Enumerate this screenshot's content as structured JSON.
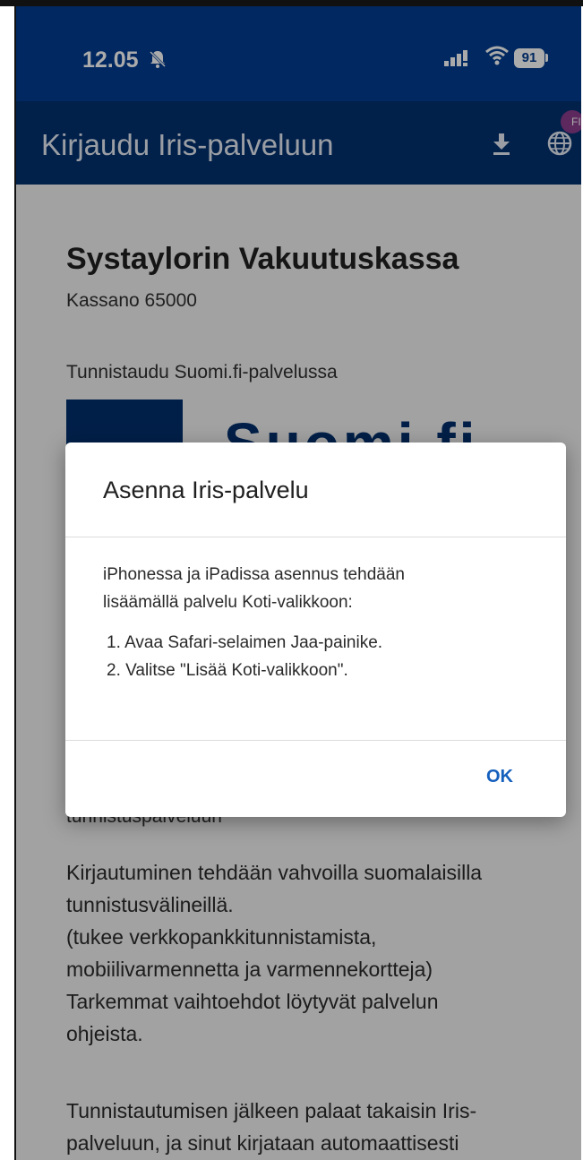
{
  "status_bar": {
    "time": "12.05",
    "battery": "91"
  },
  "app_bar": {
    "title": "Kirjaudu Iris-palveluun",
    "language_badge": "FI"
  },
  "page": {
    "heading": "Systaylorin Vakuutuskassa",
    "kassano": "Kassano 65000",
    "identify_prompt": "Tunnistaudu Suomi.fi-palvelussa",
    "suomi_logo_text": "Suomi.fi",
    "partial_line": "tunnistuspalveluun",
    "info_lines": [
      "Kirjautuminen tehdään vahvoilla suomalaisilla",
      "tunnistusvälineillä.",
      "(tukee verkkopankkitunnistamista,",
      "mobiilivarmennetta ja varmennekortteja)",
      "Tarkemmat vaihtoehdot löytyvät palvelun",
      "ohjeista."
    ],
    "return_lines": [
      "Tunnistautumisen jälkeen palaat takaisin Iris-",
      "palveluun, ja sinut kirjataan automaattisesti"
    ]
  },
  "dialog": {
    "title": "Asenna Iris-palvelu",
    "intro_line1": "iPhonessa ja iPadissa asennus tehdään",
    "intro_line2": "lisäämällä palvelu Koti-valikkoon:",
    "steps": [
      "1.  Avaa Safari-selaimen Jaa-painike.",
      "2.  Valitse \"Lisää Koti-valikkoon\"."
    ],
    "ok_label": "OK"
  },
  "colors": {
    "status_bar": "#023c8f",
    "app_bar": "#02306f",
    "ok_button": "#1560bd"
  },
  "icons": [
    "bell-muted-icon",
    "signal-icon",
    "wifi-icon",
    "battery-icon",
    "download-icon",
    "globe-icon"
  ]
}
